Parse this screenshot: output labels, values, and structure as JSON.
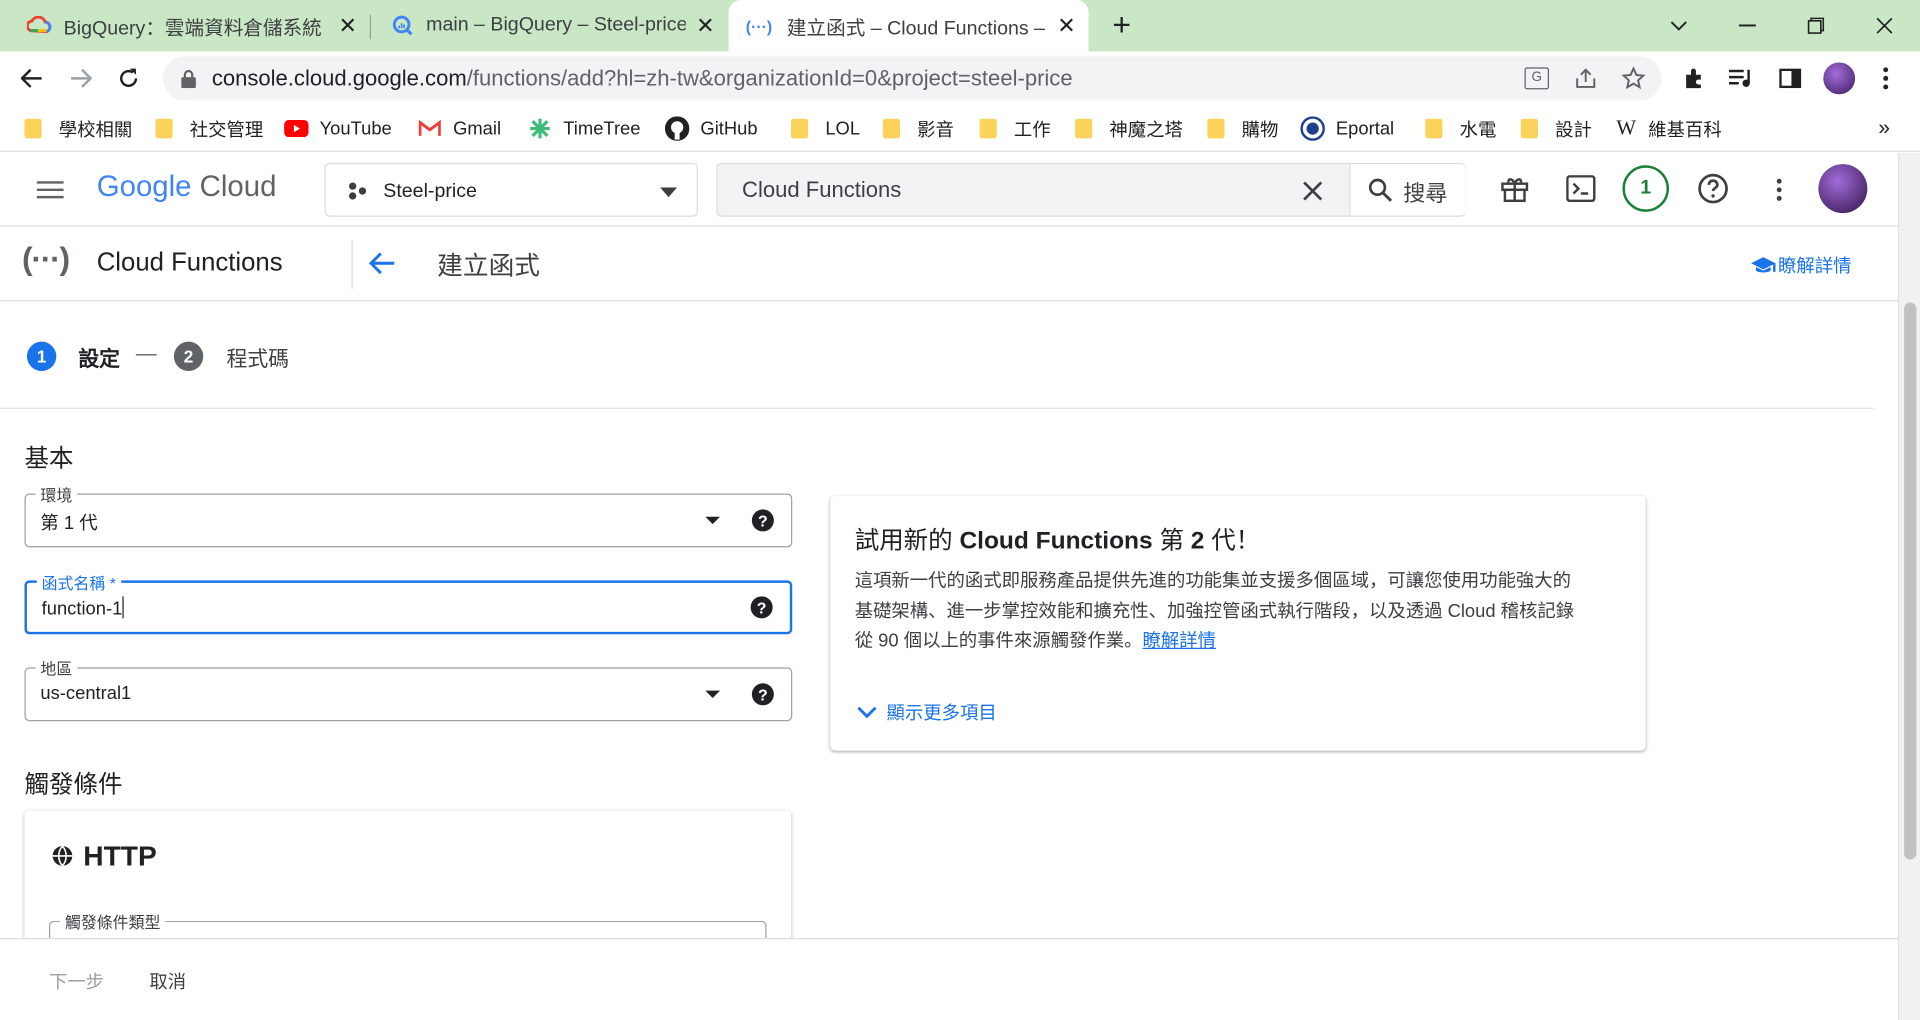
{
  "browser": {
    "tabs": [
      {
        "title": "BigQuery：雲端資料倉儲系統",
        "active": false
      },
      {
        "title": "main – BigQuery – Steel-price",
        "active": false
      },
      {
        "title": "建立函式 – Cloud Functions – St",
        "active": true
      }
    ],
    "new_tab": "+",
    "url_host": "console.cloud.google.com",
    "url_path": "/functions/add?hl=zh-tw&organizationId=0&project=steel-price",
    "bookmarks": [
      "學校相關",
      "社交管理",
      "YouTube",
      "Gmail",
      "TimeTree",
      "GitHub",
      "LOL",
      "影音",
      "工作",
      "神魔之塔",
      "購物",
      "Eportal",
      "水電",
      "設計",
      "維基百科"
    ],
    "bookmarks_more": "»"
  },
  "header": {
    "logo_google": "Google",
    "logo_cloud": "Cloud",
    "project": "Steel-price",
    "search_value": "Cloud Functions",
    "search_button": "搜尋",
    "notification_count": "1"
  },
  "subheader": {
    "product": "Cloud Functions",
    "page_title": "建立函式",
    "learn_more": "瞭解詳情"
  },
  "stepper": {
    "step1_num": "1",
    "step1_label": "設定",
    "dash": "—",
    "step2_num": "2",
    "step2_label": "程式碼"
  },
  "form": {
    "section_basic": "基本",
    "env_label": "環境",
    "env_value": "第 1 代",
    "name_label": "函式名稱 *",
    "name_value": "function-1",
    "region_label": "地區",
    "region_value": "us-central1",
    "section_trigger": "觸發條件",
    "http_title": "HTTP",
    "trigger_type_label": "觸發條件類型"
  },
  "promo": {
    "title_pre": "試用新的 ",
    "title_bold": "Cloud Functions",
    "title_mid": " 第 ",
    "title_num": "2",
    "title_post": " 代！",
    "body_line1": "這項新一代的函式即服務產品提供先進的功能集並支援多個區域，可讓您使用功能強大的",
    "body_line2": "基礎架構、進一步掌控效能和擴充性、加強控管函式執行階段，以及透過 Cloud 稽核記錄",
    "body_line3": "從 90 個以上的事件來源觸發作業。",
    "learn_more": "瞭解詳情",
    "show_more": "顯示更多項目"
  },
  "footer": {
    "next": "下一步",
    "cancel": "取消"
  },
  "colors": {
    "tabbar": "#c9e6c5",
    "accent": "#1a73e8",
    "step_active": "#1a73e8",
    "step_inactive": "#5f6368"
  }
}
